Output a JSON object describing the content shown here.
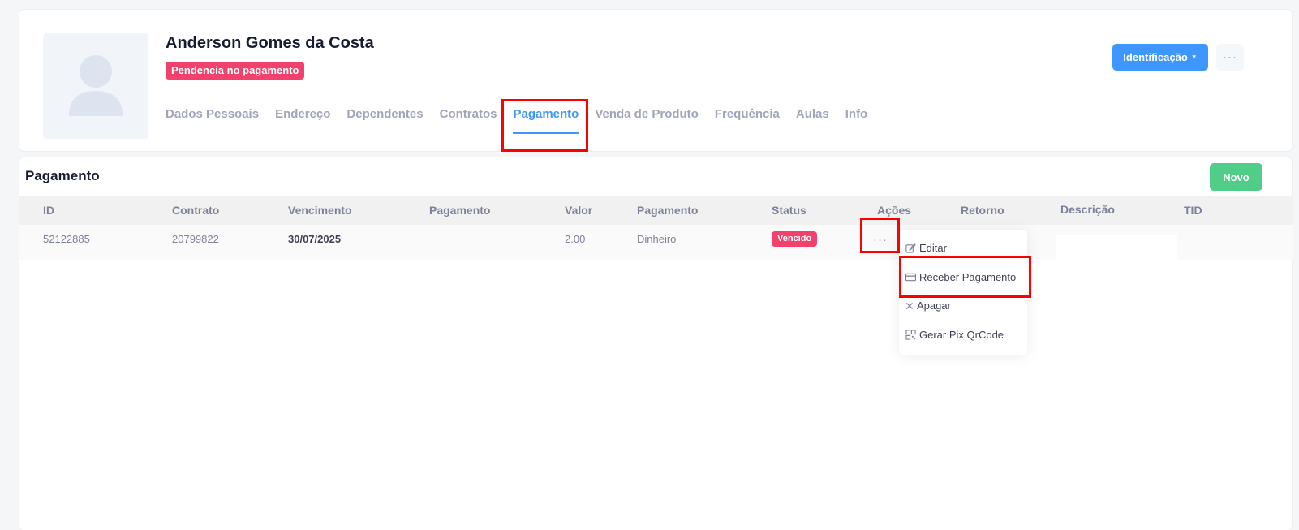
{
  "profile": {
    "name": "Anderson Gomes da Costa",
    "badge": "Pendencia no pagamento",
    "tabs": [
      "Dados Pessoais",
      "Endereço",
      "Dependentes",
      "Contratos",
      "Pagamento",
      "Venda de Produto",
      "Frequência",
      "Aulas",
      "Info"
    ],
    "active_tab": "Pagamento",
    "identification_button": "Identificação",
    "more_button": "···"
  },
  "payments": {
    "title": "Pagamento",
    "new_button": "Novo",
    "columns": [
      "ID",
      "Contrato",
      "Vencimento",
      "Pagamento",
      "Valor",
      "Pagamento",
      "Status",
      "Ações",
      "Retorno",
      "Descrição",
      "TID"
    ],
    "rows": [
      {
        "id": "52122885",
        "contrato": "20799822",
        "vencimento": "30/07/2025",
        "pagamento_data": "",
        "valor": "2.00",
        "forma_pagamento": "Dinheiro",
        "status": "Vencido",
        "acoes": "···"
      }
    ]
  },
  "actions_menu": {
    "items": [
      {
        "label": "Editar",
        "icon": "edit-icon"
      },
      {
        "label": "Receber Pagamento",
        "icon": "credit-card-icon"
      },
      {
        "label": "Apagar",
        "icon": "close-icon"
      },
      {
        "label": "Gerar Pix QrCode",
        "icon": "qrcode-icon"
      }
    ]
  },
  "colors": {
    "primary": "#3e97ff",
    "success": "#50cd89",
    "danger": "#f1416c",
    "highlight": "#ff0000"
  }
}
